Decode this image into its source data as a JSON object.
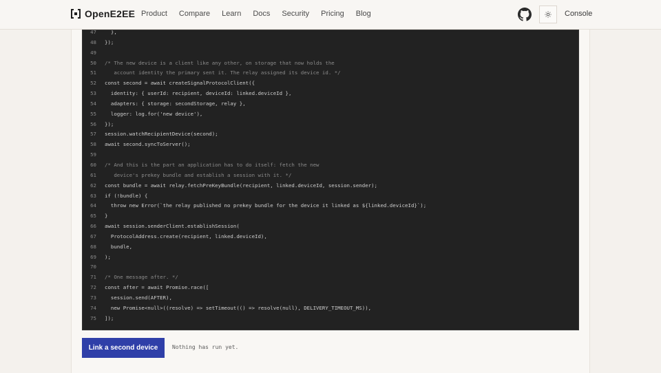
{
  "brand": {
    "name": "OpenE2EE"
  },
  "nav": [
    "Product",
    "Compare",
    "Learn",
    "Docs",
    "Security",
    "Pricing",
    "Blog"
  ],
  "header_right": {
    "console_label": "Console",
    "theme_icon": "sun-icon",
    "repo_icon": "github-icon"
  },
  "code_lines": [
    {
      "n": "47",
      "t": "  },",
      "c": "src"
    },
    {
      "n": "48",
      "t": "});",
      "c": "src"
    },
    {
      "n": "49",
      "t": "",
      "c": "src"
    },
    {
      "n": "50",
      "t": "/* The new device is a client like any other, on storage that now holds the",
      "c": "cm"
    },
    {
      "n": "51",
      "t": "   account identity the primary sent it. The relay assigned its device id. */",
      "c": "cm"
    },
    {
      "n": "52",
      "t": "const second = await createSignalProtocolClient({",
      "c": "src"
    },
    {
      "n": "53",
      "t": "  identity: { userId: recipient, deviceId: linked.deviceId },",
      "c": "src"
    },
    {
      "n": "54",
      "t": "  adapters: { storage: secondStorage, relay },",
      "c": "src"
    },
    {
      "n": "55",
      "t": "  logger: log.for('new device'),",
      "c": "src"
    },
    {
      "n": "56",
      "t": "});",
      "c": "src"
    },
    {
      "n": "57",
      "t": "session.watchRecipientDevice(second);",
      "c": "src"
    },
    {
      "n": "58",
      "t": "await second.syncToServer();",
      "c": "src"
    },
    {
      "n": "59",
      "t": "",
      "c": "src"
    },
    {
      "n": "60",
      "t": "/* And this is the part an application has to do itself: fetch the new",
      "c": "cm"
    },
    {
      "n": "61",
      "t": "   device's prekey bundle and establish a session with it. */",
      "c": "cm"
    },
    {
      "n": "62",
      "t": "const bundle = await relay.fetchPreKeyBundle(recipient, linked.deviceId, session.sender);",
      "c": "src"
    },
    {
      "n": "63",
      "t": "if (!bundle) {",
      "c": "src"
    },
    {
      "n": "64",
      "t": "  throw new Error(`the relay published no prekey bundle for the device it linked as ${linked.deviceId}`);",
      "c": "src"
    },
    {
      "n": "65",
      "t": "}",
      "c": "src"
    },
    {
      "n": "66",
      "t": "await session.senderClient.establishSession(",
      "c": "src"
    },
    {
      "n": "67",
      "t": "  ProtocolAddress.create(recipient, linked.deviceId),",
      "c": "src"
    },
    {
      "n": "68",
      "t": "  bundle,",
      "c": "src"
    },
    {
      "n": "69",
      "t": ");",
      "c": "src"
    },
    {
      "n": "70",
      "t": "",
      "c": "src"
    },
    {
      "n": "71",
      "t": "/* One message after. */",
      "c": "cm"
    },
    {
      "n": "72",
      "t": "const after = await Promise.race([",
      "c": "src"
    },
    {
      "n": "73",
      "t": "  session.send(AFTER),",
      "c": "src"
    },
    {
      "n": "74",
      "t": "  new Promise<null>((resolve) => setTimeout(() => resolve(null), DELIVERY_TIMEOUT_MS)),",
      "c": "src"
    },
    {
      "n": "75",
      "t": "]);",
      "c": "src"
    }
  ],
  "actions": {
    "run_label": "Link a second device",
    "status_text": "Nothing has run yet."
  },
  "colors": {
    "accent": "#2f3fa8",
    "code_bg": "#222222",
    "page_bg": "#f4f1ed"
  }
}
